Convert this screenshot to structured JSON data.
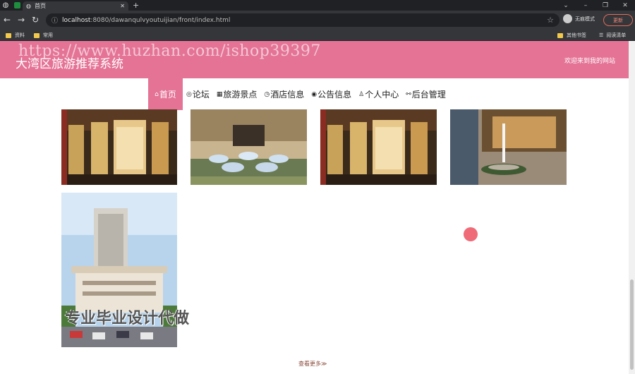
{
  "browser": {
    "tab_title": "首页",
    "url_host": "localhost",
    "url_path": ":8080/dawanqulvyoutuijian/front/index.html",
    "incognito_label": "无痕模式",
    "update_label": "更新",
    "bookmarks": [
      "资料",
      "常用"
    ],
    "bookmarks_right": [
      "其他书签",
      "阅读清单"
    ]
  },
  "header": {
    "watermark": "https://www.huzhan.com/ishop39397",
    "title": "大湾区旅游推荐系统",
    "welcome": "欢迎来到我的网站"
  },
  "nav": {
    "items": [
      {
        "icon": "home-icon",
        "glyph": "⌂",
        "label": "首页",
        "active": true
      },
      {
        "icon": "forum-icon",
        "glyph": "◎",
        "label": "论坛"
      },
      {
        "icon": "scenic-icon",
        "glyph": "▦",
        "label": "旅游景点"
      },
      {
        "icon": "hotel-icon",
        "glyph": "◷",
        "label": "酒店信息"
      },
      {
        "icon": "notice-icon",
        "glyph": "◉",
        "label": "公告信息"
      },
      {
        "icon": "user-icon",
        "glyph": "♙",
        "label": "个人中心"
      },
      {
        "icon": "admin-link-icon",
        "glyph": "⚯",
        "label": "后台管理"
      }
    ]
  },
  "gallery": {
    "overlay_text": "专业毕业设计代做",
    "more_label": "查看更多≫"
  },
  "colors": {
    "accent": "#e47396"
  }
}
